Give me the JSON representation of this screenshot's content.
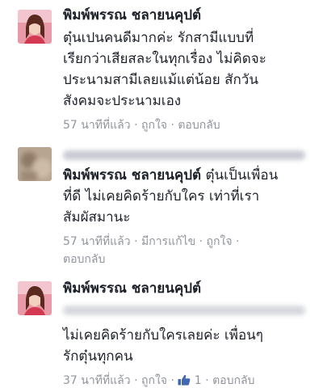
{
  "comments": [
    {
      "author": "พิมพ์พรรณ ชลายนคุปต์",
      "lines": [
        "ตุ๋นเปนคนดีมากค่ะ รักสามีแบบที่",
        "เรียกว่าเสียสละในทุกเรื่อง ไม่คิดจะ",
        "ประนามสามีเลยแม้แต่น้อย สักวัน",
        "สังคมจะประนามเอง"
      ],
      "time": "57 นาทีที่แล้ว",
      "like": "ถูกใจ",
      "reply": "ตอบกลับ"
    },
    {
      "author": "พิมพ์พรรณ ชลายนคุปต์",
      "lines": [
        "ตุ๋นเป็นเพื่อน",
        "ที่ดี ไม่เคยคิดร้ายกับใคร เท่าที่เรา",
        "สัมผัสมานะ"
      ],
      "time": "57 นาทีที่แล้ว",
      "edited": "มีการแก้ไข",
      "like": "ถูกใจ",
      "reply": "ตอบกลับ"
    },
    {
      "author": "พิมพ์พรรณ ชลายนคุปต์",
      "lines": [
        "ไม่เคยคิดร้ายกับใครเลยค่ะ เพื่อนๆ",
        "รักตุ๋นทุกคน"
      ],
      "time": "37 นาทีที่แล้ว",
      "like": "ถูกใจ",
      "like_count": "1",
      "reply": "ตอบกลับ"
    }
  ],
  "colors": {
    "text": "#1d2129",
    "meta": "#90949c",
    "like_blue": "#4267b2"
  },
  "separator": "·"
}
